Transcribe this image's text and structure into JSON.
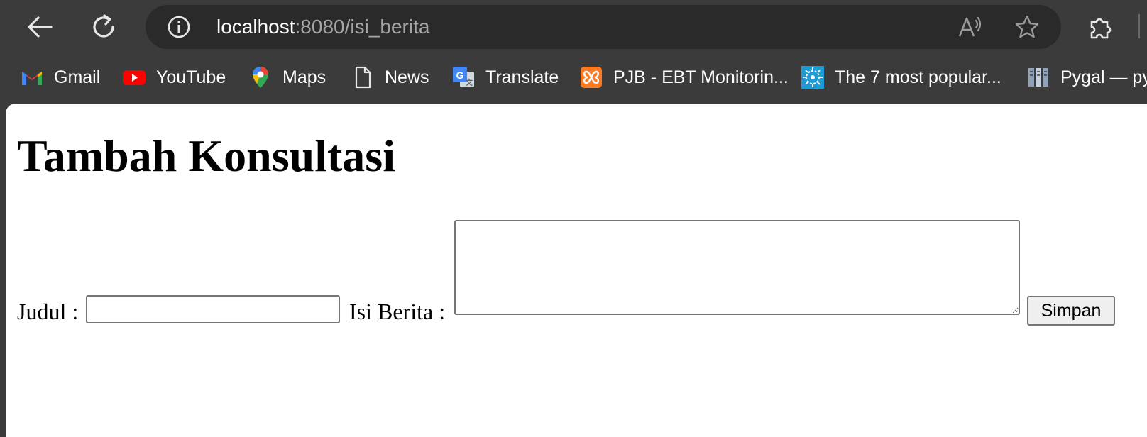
{
  "browser": {
    "url_host": "localhost",
    "url_path": ":8080/isi_berita",
    "icons": {
      "back": "back-arrow-icon",
      "reload": "reload-icon",
      "site_info": "info-icon",
      "read_aloud": "read-aloud-icon",
      "favorite": "star-icon",
      "extensions": "puzzle-icon"
    }
  },
  "bookmarks": [
    {
      "label": "Gmail",
      "icon": "gmail-icon"
    },
    {
      "label": "YouTube",
      "icon": "youtube-icon"
    },
    {
      "label": "Maps",
      "icon": "maps-icon"
    },
    {
      "label": "News",
      "icon": "page-icon"
    },
    {
      "label": "Translate",
      "icon": "translate-icon"
    },
    {
      "label": "PJB - EBT Monitorin...",
      "icon": "xampp-icon"
    },
    {
      "label": "The 7 most popular...",
      "icon": "site-icon"
    },
    {
      "label": "Pygal — py",
      "icon": "pygal-icon"
    }
  ],
  "page": {
    "title": "Tambah Konsultasi",
    "form": {
      "judul_label": "Judul :",
      "judul_value": "",
      "isi_label": "Isi Berita :",
      "isi_value": "",
      "submit_label": "Simpan"
    }
  },
  "colors": {
    "chrome_bg": "#3b3b3b",
    "addressbar_bg": "#2a2a2a",
    "page_bg": "#ffffff"
  }
}
